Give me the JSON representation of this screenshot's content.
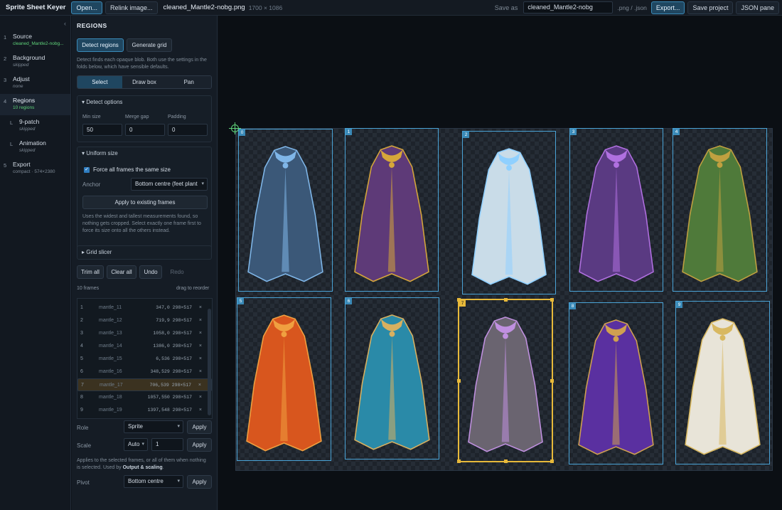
{
  "topbar": {
    "app_title": "Sprite Sheet Keyer",
    "open_label": "Open...",
    "relink_label": "Relink image...",
    "filename": "cleaned_Mantle2-nobg.png",
    "dimensions": "1700 × 1086",
    "save_as_label": "Save as",
    "save_name": "cleaned_Mantle2-nobg",
    "extensions": ".png / .json",
    "export_label": "Export...",
    "save_project_label": "Save project",
    "json_pane_label": "JSON pane"
  },
  "nav": {
    "collapse_icon": "chevron-left",
    "steps": [
      {
        "num": "1",
        "label": "Source",
        "sub": "cleaned_Mantle2-nobg..."
      },
      {
        "num": "2",
        "label": "Background",
        "sub": "skipped"
      },
      {
        "num": "3",
        "label": "Adjust",
        "sub": "none"
      },
      {
        "num": "4",
        "label": "Regions",
        "sub": "10 regions"
      },
      {
        "num": "L",
        "label": "9-patch",
        "sub": "skipped"
      },
      {
        "num": "L",
        "label": "Animation",
        "sub": "skipped"
      },
      {
        "num": "5",
        "label": "Export",
        "sub": "compact · 574×2380"
      }
    ]
  },
  "panel": {
    "title": "REGIONS",
    "detect_label": "Detect regions",
    "grid_label": "Generate grid",
    "help": "Detect finds each opaque blob. Both use the settings in the folds below, which have sensible defaults.",
    "modes": [
      "Select",
      "Draw box",
      "Pan"
    ],
    "detect_options": {
      "title": "Detect options",
      "min_size_label": "Min size",
      "min_size": "50",
      "merge_gap_label": "Merge gap",
      "merge_gap": "0",
      "padding_label": "Padding",
      "padding": "0"
    },
    "uniform": {
      "title": "Uniform size",
      "force_label": "Force all frames the same size",
      "anchor_label": "Anchor",
      "anchor_value": "Bottom centre (feet plant",
      "apply_label": "Apply to existing frames",
      "help": "Uses the widest and tallest measurements found, so nothing gets cropped. Select exactly one frame first to force its size onto all the others instead."
    },
    "grid_slicer": "Grid slicer",
    "actions": {
      "trim": "Trim all",
      "clear": "Clear all",
      "undo": "Undo",
      "redo": "Redo"
    },
    "frames_count": "10 frames",
    "reorder_hint": "drag to reorder",
    "frames": [
      {
        "i": "1",
        "name": "mantle_11",
        "coords": "347,0 298×517"
      },
      {
        "i": "2",
        "name": "mantle_12",
        "coords": "719,9 298×517"
      },
      {
        "i": "3",
        "name": "mantle_13",
        "coords": "1058,0 298×517"
      },
      {
        "i": "4",
        "name": "mantle_14",
        "coords": "1386,0 298×517"
      },
      {
        "i": "5",
        "name": "mantle_15",
        "coords": "6,536 298×517"
      },
      {
        "i": "6",
        "name": "mantle_16",
        "coords": "348,529 298×517"
      },
      {
        "i": "7",
        "name": "mantle_17",
        "coords": "706,539 298×517"
      },
      {
        "i": "8",
        "name": "mantle_18",
        "coords": "1057,550 298×517"
      },
      {
        "i": "9",
        "name": "mantle_19",
        "coords": "1397,548 298×517"
      }
    ],
    "role_label": "Role",
    "role_value": "Sprite",
    "apply1": "Apply",
    "scale_label": "Scale",
    "scale_mode": "Auto",
    "scale_value": "1",
    "apply2": "Apply",
    "scale_help_1": "Applies to the selected frames, or all of them when nothing is selected. Used by ",
    "scale_help_bold": "Output & scaling",
    "pivot_label": "Pivot",
    "pivot_value": "Bottom centre",
    "apply3": "Apply"
  },
  "canvas": {
    "frame_labels": [
      "0",
      "1",
      "2",
      "3",
      "4",
      "5",
      "6",
      "7",
      "8",
      "9"
    ],
    "cloak_colors": [
      "#3b5878",
      "#5e3a78",
      "#c9dce8",
      "#5a3a82",
      "#4f7a3a",
      "#d8561e",
      "#2a8aa8",
      "#6a6470",
      "#5a30a0",
      "#e8e4d8"
    ],
    "trim_colors": [
      "#7fb6e8",
      "#d6a63a",
      "#8fd0ff",
      "#b070e0",
      "#c0a040",
      "#f0a040",
      "#d8b060",
      "#c090e0",
      "#d0a050",
      "#d8b860"
    ]
  }
}
